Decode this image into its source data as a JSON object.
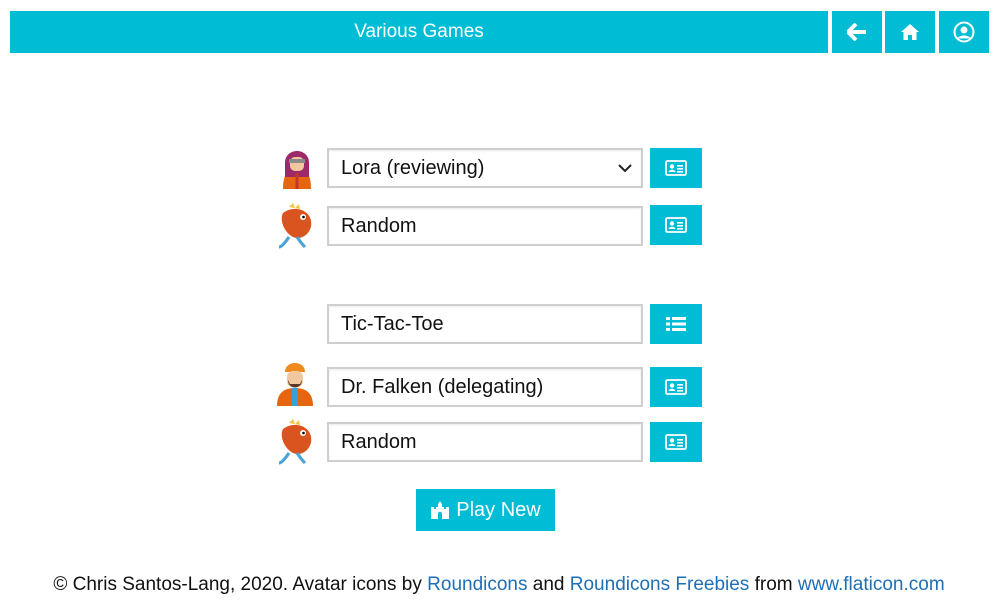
{
  "header": {
    "title": "Various Games",
    "back_icon": "arrow-left-icon",
    "home_icon": "home-icon",
    "profile_icon": "user-circle-icon"
  },
  "players": [
    {
      "avatar": "hooded-girl-avatar",
      "value": "Lora (reviewing)",
      "type": "select",
      "button_icon": "id-card-icon"
    },
    {
      "avatar": "fish-avatar",
      "value": "Random",
      "type": "input",
      "button_icon": "id-card-icon"
    }
  ],
  "game": {
    "value": "Tic-Tac-Toe",
    "button_icon": "list-icon"
  },
  "opponents": [
    {
      "avatar": "man-turban-avatar",
      "value": "Dr. Falken (delegating)",
      "button_icon": "id-card-icon"
    },
    {
      "avatar": "fish-avatar",
      "value": "Random",
      "button_icon": "id-card-icon"
    }
  ],
  "play_button": {
    "label": "Play New",
    "icon": "castle-icon"
  },
  "footer": {
    "prefix": "© Chris Santos-Lang, 2020. Avatar icons by ",
    "link1": "Roundicons",
    "and": " and ",
    "link2": "Roundicons Freebies",
    "from": " from ",
    "link3": "www.flaticon.com"
  },
  "colors": {
    "accent": "#00bcd4",
    "link": "#1f6fb5"
  }
}
